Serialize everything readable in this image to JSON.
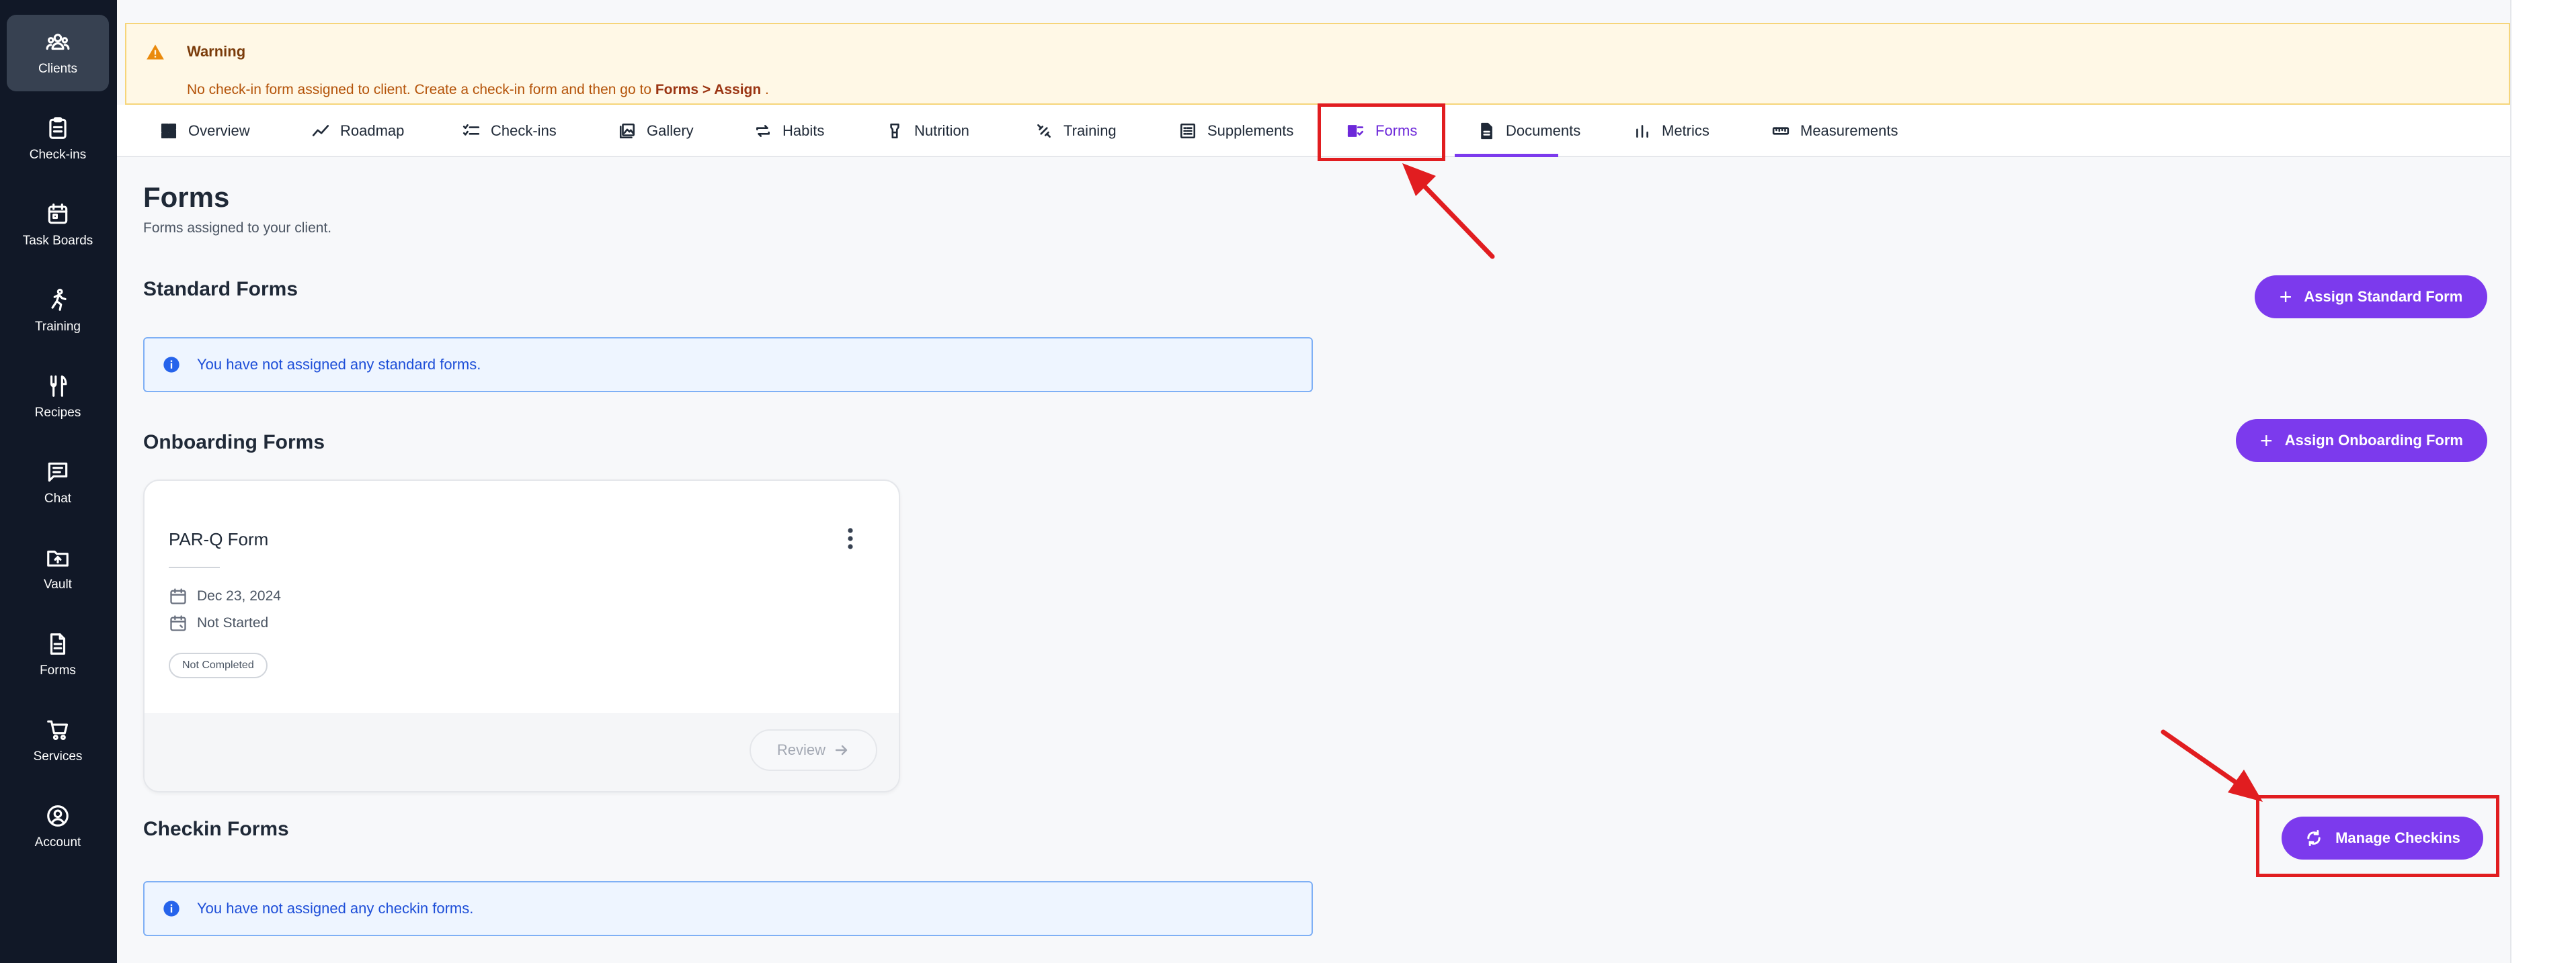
{
  "sidebar": {
    "items": [
      {
        "label": "Clients",
        "icon": "users-icon",
        "active": true
      },
      {
        "label": "Check-ins",
        "icon": "clipboard-icon"
      },
      {
        "label": "Task Boards",
        "icon": "calendar-icon"
      },
      {
        "label": "Training",
        "icon": "running-icon"
      },
      {
        "label": "Recipes",
        "icon": "utensils-icon"
      },
      {
        "label": "Chat",
        "icon": "chat-icon"
      },
      {
        "label": "Vault",
        "icon": "folder-upload-icon"
      },
      {
        "label": "Forms",
        "icon": "document-icon"
      },
      {
        "label": "Services",
        "icon": "cart-icon"
      },
      {
        "label": "Account",
        "icon": "user-circle-icon"
      }
    ]
  },
  "warning": {
    "title": "Warning",
    "text": "No check-in form assigned to client. Create a check-in form and then go to ",
    "path": "Forms > Assign",
    "suffix": " ."
  },
  "tabs": [
    {
      "label": "Overview",
      "icon": "grid-icon"
    },
    {
      "label": "Roadmap",
      "icon": "trend-icon"
    },
    {
      "label": "Check-ins",
      "icon": "checklist-icon"
    },
    {
      "label": "Gallery",
      "icon": "gallery-icon"
    },
    {
      "label": "Habits",
      "icon": "repeat-icon"
    },
    {
      "label": "Nutrition",
      "icon": "bottle-icon"
    },
    {
      "label": "Training",
      "icon": "dumbbell-icon"
    },
    {
      "label": "Supplements",
      "icon": "list-box-icon"
    },
    {
      "label": "Forms",
      "icon": "forms-icon",
      "active": true
    },
    {
      "label": "Documents",
      "icon": "file-icon"
    },
    {
      "label": "Metrics",
      "icon": "bar-chart-icon"
    },
    {
      "label": "Measurements",
      "icon": "ruler-icon"
    }
  ],
  "page": {
    "title": "Forms",
    "subtitle": "Forms assigned to your client."
  },
  "standard": {
    "title": "Standard Forms",
    "button": "Assign Standard Form",
    "empty": "You have not assigned any standard forms."
  },
  "onboarding": {
    "title": "Onboarding Forms",
    "button": "Assign Onboarding Form",
    "card": {
      "title": "PAR-Q Form",
      "date": "Dec 23, 2024",
      "status": "Not Started",
      "badge": "Not Completed",
      "review": "Review"
    }
  },
  "checkin": {
    "title": "Checkin Forms",
    "button": "Manage Checkins",
    "empty": "You have not assigned any checkin forms."
  },
  "colors": {
    "accent": "#7c3aed",
    "sidebar": "#111827",
    "annotation": "#e11d20",
    "warning_bg": "#fff8e6",
    "info_bg": "#eef5ff"
  }
}
